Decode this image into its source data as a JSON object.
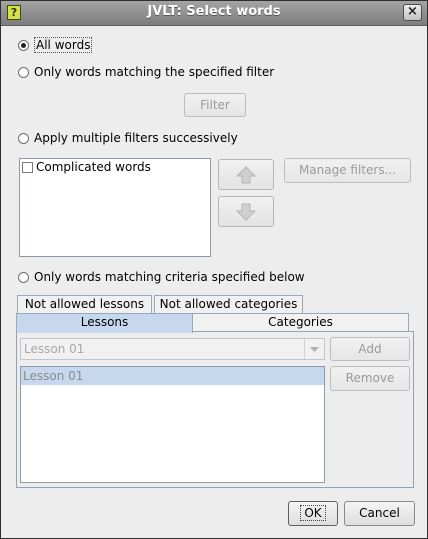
{
  "window": {
    "title": "JVLT: Select words",
    "app_icon_glyph": "?",
    "close_glyph": "×"
  },
  "modes": {
    "all_words": "All words",
    "filter_match": "Only words matching the specified filter",
    "multiple_filters": "Apply multiple filters successively",
    "criteria_below": "Only words matching criteria specified below",
    "selected": "all_words"
  },
  "buttons": {
    "filter": "Filter",
    "manage_filters": "Manage filters...",
    "add": "Add",
    "remove": "Remove",
    "ok": "OK",
    "cancel": "Cancel"
  },
  "filters_list": {
    "items": [
      {
        "label": "Complicated words",
        "checked": false
      }
    ]
  },
  "tabs": {
    "back_row": [
      "Not allowed lessons",
      "Not allowed categories"
    ],
    "front_row": [
      "Lessons",
      "Categories"
    ],
    "selected": "Lessons"
  },
  "lessons": {
    "combo_value": "Lesson 01",
    "list_items": [
      "Lesson 01"
    ]
  },
  "icons": {
    "up": "arrow-up-icon",
    "down": "arrow-down-icon",
    "combo": "chevron-down-icon"
  }
}
